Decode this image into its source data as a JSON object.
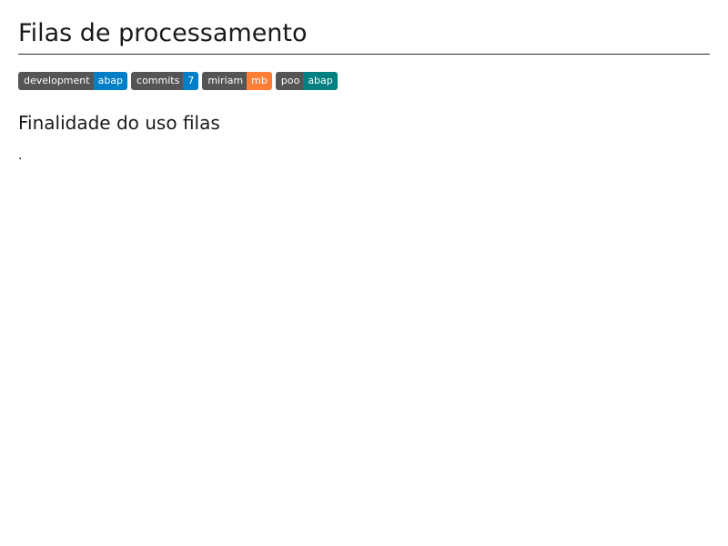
{
  "document": {
    "title": "Filas de processamento",
    "badges": [
      {
        "label": "development",
        "value": "abap",
        "color": "#007ec6"
      },
      {
        "label": "commits",
        "value": "7",
        "color": "#007ec6"
      },
      {
        "label": "miriam",
        "value": "mb",
        "color": "#fe7d37"
      },
      {
        "label": "poo",
        "value": "abap",
        "color": "#008080"
      }
    ],
    "section_heading": "Finalidade do uso filas",
    "paragraph": "."
  }
}
